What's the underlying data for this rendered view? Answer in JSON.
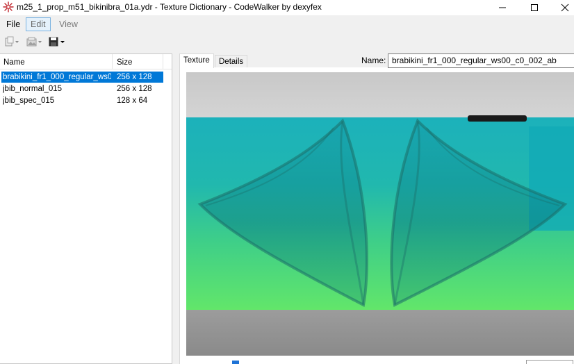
{
  "window": {
    "title": "m25_1_prop_m51_bikinibra_01a.ydr - Texture Dictionary - CodeWalker by dexyfex",
    "app_icon": "codewalker-star-icon",
    "controls": [
      "minimize-icon",
      "maximize-icon",
      "close-icon"
    ]
  },
  "menu": {
    "file": "File",
    "edit": "Edit",
    "view": "View"
  },
  "toolbar": {
    "new_icon": "new-texture-icon",
    "open_icon": "open-image-icon",
    "save_icon": "save-floppy-icon"
  },
  "list": {
    "columns": [
      "Name",
      "Size"
    ],
    "rows": [
      {
        "name": "brabikini_fr1_000_regular_ws0...",
        "size": "256 x 128",
        "selected": true
      },
      {
        "name": "jbib_normal_015",
        "size": "256 x 128",
        "selected": false
      },
      {
        "name": "jbib_spec_015",
        "size": "128 x 64",
        "selected": false
      }
    ]
  },
  "viewer": {
    "tabs": [
      "Texture",
      "Details"
    ],
    "active_tab": "Texture",
    "name_label": "Name:",
    "name_value": "brabikini_fr1_000_regular_ws00_c0_002_ab"
  },
  "colors": {
    "selection": "#0078d7",
    "texture_top": "#1fb3b8",
    "texture_bottom": "#5ee36a",
    "background_gray": "#d8d8d8"
  }
}
